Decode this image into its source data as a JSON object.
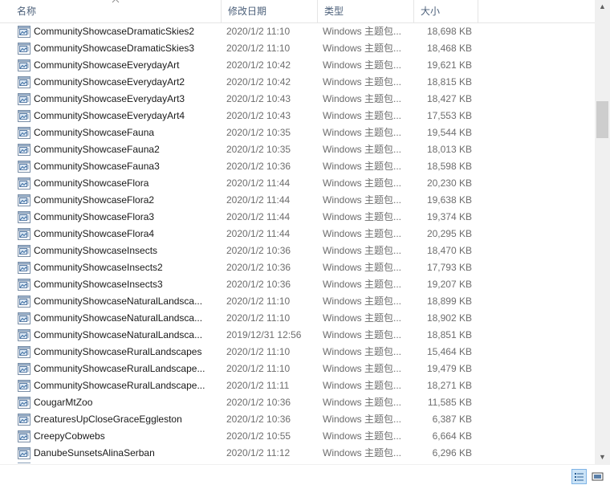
{
  "columns": {
    "name": "名称",
    "date": "修改日期",
    "type": "类型",
    "size": "大小"
  },
  "sort": {
    "column": "name",
    "direction": "ascending"
  },
  "files": [
    {
      "name": "CommunityShowcaseDramaticSkies2",
      "date": "2020/1/2 11:10",
      "type": "Windows 主题包...",
      "size": "18,698 KB"
    },
    {
      "name": "CommunityShowcaseDramaticSkies3",
      "date": "2020/1/2 11:10",
      "type": "Windows 主题包...",
      "size": "18,468 KB"
    },
    {
      "name": "CommunityShowcaseEverydayArt",
      "date": "2020/1/2 10:42",
      "type": "Windows 主题包...",
      "size": "19,621 KB"
    },
    {
      "name": "CommunityShowcaseEverydayArt2",
      "date": "2020/1/2 10:42",
      "type": "Windows 主题包...",
      "size": "18,815 KB"
    },
    {
      "name": "CommunityShowcaseEverydayArt3",
      "date": "2020/1/2 10:43",
      "type": "Windows 主题包...",
      "size": "18,427 KB"
    },
    {
      "name": "CommunityShowcaseEverydayArt4",
      "date": "2020/1/2 10:43",
      "type": "Windows 主题包...",
      "size": "17,553 KB"
    },
    {
      "name": "CommunityShowcaseFauna",
      "date": "2020/1/2 10:35",
      "type": "Windows 主题包...",
      "size": "19,544 KB"
    },
    {
      "name": "CommunityShowcaseFauna2",
      "date": "2020/1/2 10:35",
      "type": "Windows 主题包...",
      "size": "18,013 KB"
    },
    {
      "name": "CommunityShowcaseFauna3",
      "date": "2020/1/2 10:36",
      "type": "Windows 主题包...",
      "size": "18,598 KB"
    },
    {
      "name": "CommunityShowcaseFlora",
      "date": "2020/1/2 11:44",
      "type": "Windows 主题包...",
      "size": "20,230 KB"
    },
    {
      "name": "CommunityShowcaseFlora2",
      "date": "2020/1/2 11:44",
      "type": "Windows 主题包...",
      "size": "19,638 KB"
    },
    {
      "name": "CommunityShowcaseFlora3",
      "date": "2020/1/2 11:44",
      "type": "Windows 主题包...",
      "size": "19,374 KB"
    },
    {
      "name": "CommunityShowcaseFlora4",
      "date": "2020/1/2 11:44",
      "type": "Windows 主题包...",
      "size": "20,295 KB"
    },
    {
      "name": "CommunityShowcaseInsects",
      "date": "2020/1/2 10:36",
      "type": "Windows 主题包...",
      "size": "18,470 KB"
    },
    {
      "name": "CommunityShowcaseInsects2",
      "date": "2020/1/2 10:36",
      "type": "Windows 主题包...",
      "size": "17,793 KB"
    },
    {
      "name": "CommunityShowcaseInsects3",
      "date": "2020/1/2 10:36",
      "type": "Windows 主题包...",
      "size": "19,207 KB"
    },
    {
      "name": "CommunityShowcaseNaturalLandsca...",
      "date": "2020/1/2 11:10",
      "type": "Windows 主题包...",
      "size": "18,899 KB"
    },
    {
      "name": "CommunityShowcaseNaturalLandsca...",
      "date": "2020/1/2 11:10",
      "type": "Windows 主题包...",
      "size": "18,902 KB"
    },
    {
      "name": "CommunityShowcaseNaturalLandsca...",
      "date": "2019/12/31 12:56",
      "type": "Windows 主题包...",
      "size": "18,851 KB"
    },
    {
      "name": "CommunityShowcaseRuralLandscapes",
      "date": "2020/1/2 11:10",
      "type": "Windows 主题包...",
      "size": "15,464 KB"
    },
    {
      "name": "CommunityShowcaseRuralLandscape...",
      "date": "2020/1/2 11:10",
      "type": "Windows 主题包...",
      "size": "19,479 KB"
    },
    {
      "name": "CommunityShowcaseRuralLandscape...",
      "date": "2020/1/2 11:11",
      "type": "Windows 主题包...",
      "size": "18,271 KB"
    },
    {
      "name": "CougarMtZoo",
      "date": "2020/1/2 10:36",
      "type": "Windows 主题包...",
      "size": "11,585 KB"
    },
    {
      "name": "CreaturesUpCloseGraceEggleston",
      "date": "2020/1/2 10:36",
      "type": "Windows 主题包...",
      "size": "6,387 KB"
    },
    {
      "name": "CreepyCobwebs",
      "date": "2020/1/2 10:55",
      "type": "Windows 主题包...",
      "size": "6,664 KB"
    },
    {
      "name": "DanubeSunsetsAlinaSerban",
      "date": "2020/1/2 11:12",
      "type": "Windows 主题包...",
      "size": "6,296 KB"
    }
  ],
  "icons": {
    "file": "theme-pack-file-icon",
    "sort": "sort-ascending-icon",
    "scroll_up": "scroll-up-icon",
    "scroll_down": "scroll-down-icon",
    "details_view": "details-view-icon",
    "thumbnail_view": "large-icons-view-icon"
  },
  "colors": {
    "header_text": "#4c607a",
    "secondary_text": "#6d6d6d",
    "selected_view": "#cce4f7"
  }
}
